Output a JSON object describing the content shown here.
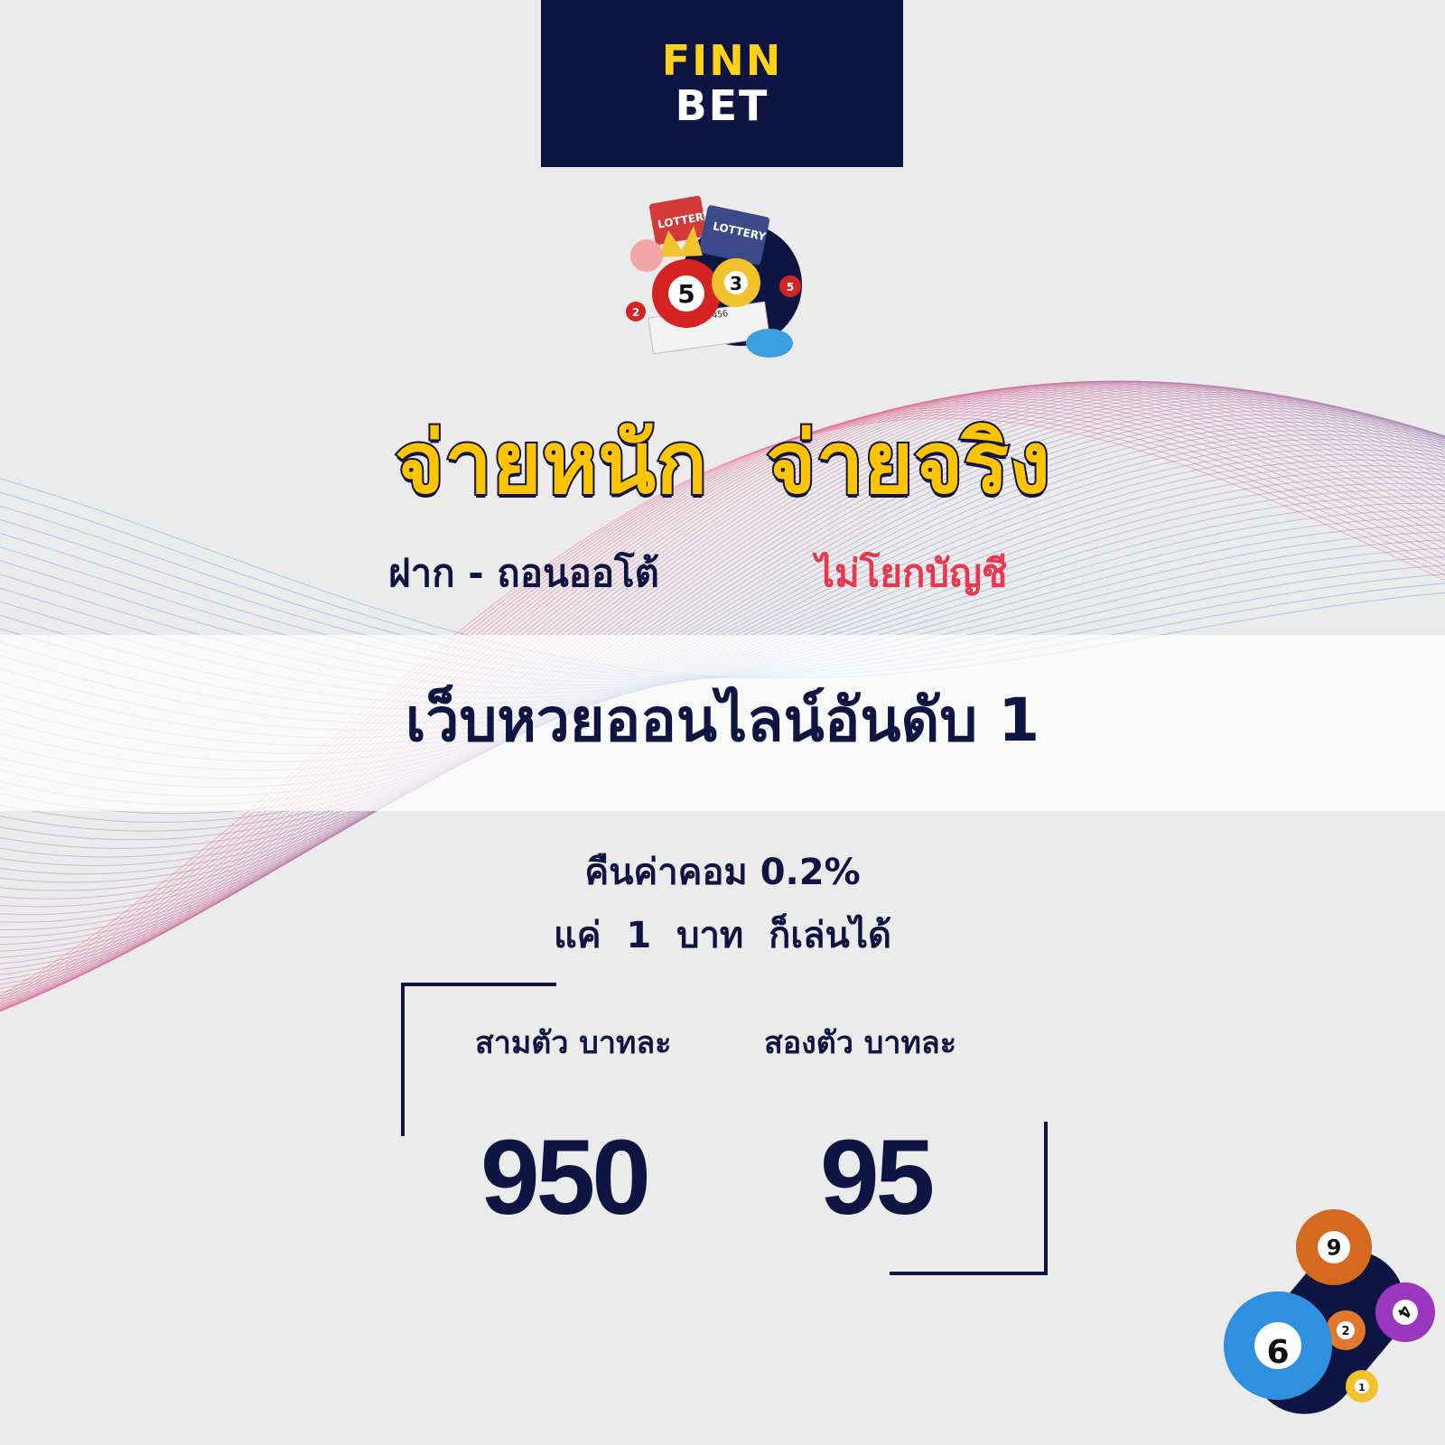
{
  "logo": {
    "line1": "FINN",
    "line2": "BET",
    "box_color": "#0f1542",
    "accent": "#ffd21a"
  },
  "hero_image": "lottery-balls-and-tickets-illustration",
  "hero_image_text": [
    "LOTTERY",
    "LOTTERY",
    "5",
    "3",
    "5",
    "2",
    "123456"
  ],
  "headline": "จ่ายหนัก  จ่ายจริง",
  "sub_left": "ฝาก - ถอนออโต้",
  "sub_right": "ไม่โยกบัญชี",
  "band_text": "เว็บหวยออนไลน์อันดับ 1",
  "info_line1": "คืนค่าคอม 0.2%",
  "info_line2": "แค่  1  บาท  ก็เล่นได้",
  "three_digit": {
    "label": "สามตัว บาทละ",
    "value": "950"
  },
  "two_digit": {
    "label": "สองตัว บาทละ",
    "value": "95"
  },
  "corner_balls": [
    "6",
    "4",
    "2",
    "9",
    "1"
  ],
  "colors": {
    "navy": "#0f1542",
    "yellow": "#ffc400",
    "red": "#e63950"
  }
}
